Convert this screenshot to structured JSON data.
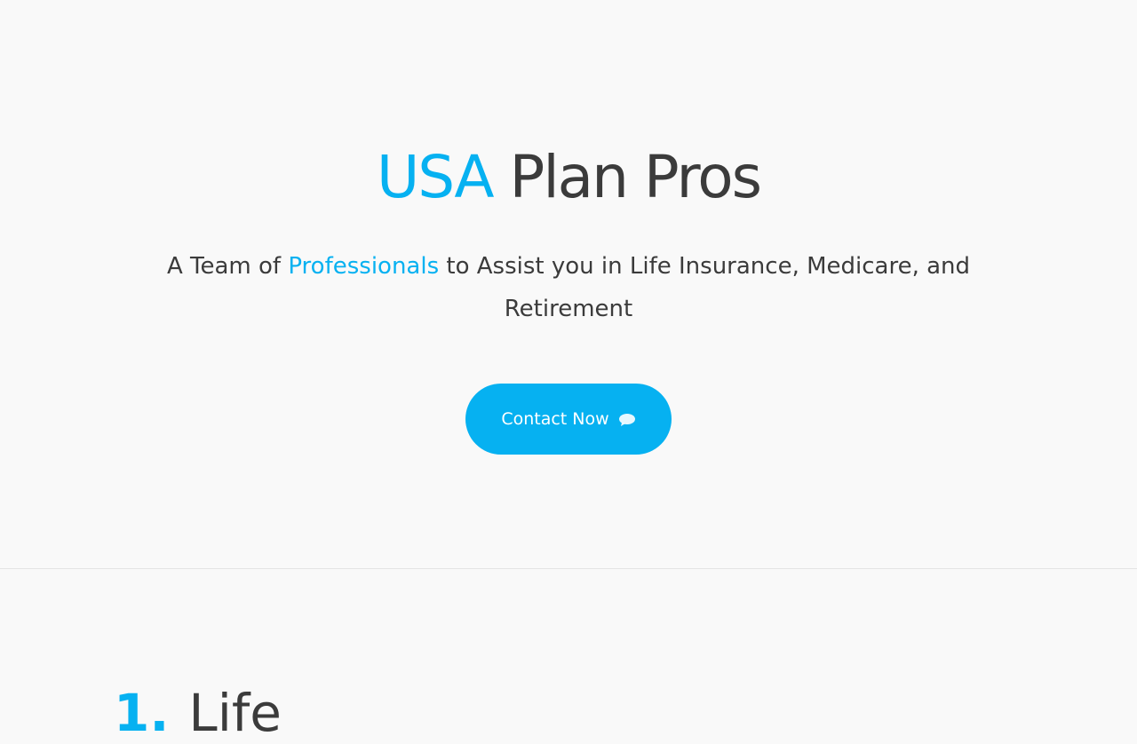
{
  "hero": {
    "title_accent": "USA",
    "title_rest": " Plan Pros",
    "tagline_before": "A Team of ",
    "tagline_highlight": "Professionals",
    "tagline_after": " to Assist you in Life Insurance, Medicare, and Retirement",
    "cta_label": "Contact Now",
    "cta_icon": "chat-bubble-icon"
  },
  "colors": {
    "accent": "#06b1f1",
    "text": "#3b3b3b",
    "background": "#f9f9f9"
  },
  "section": {
    "number": "1.",
    "heading": "Life"
  }
}
